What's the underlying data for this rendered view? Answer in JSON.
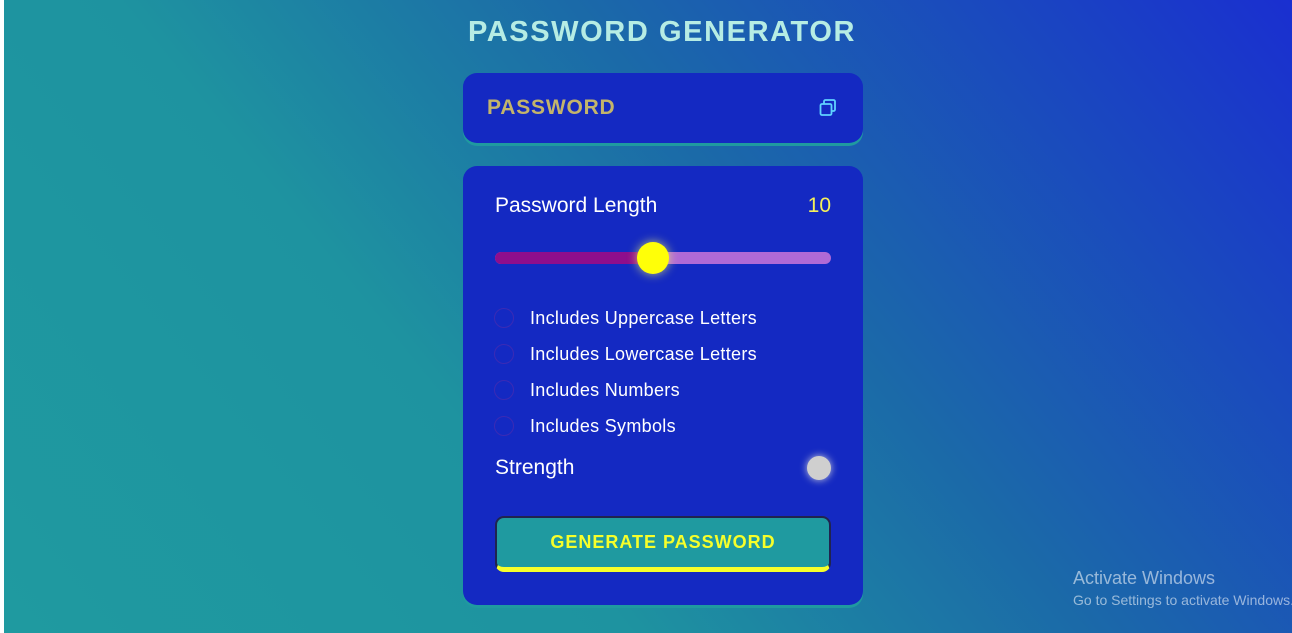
{
  "app": {
    "title": "PASSWORD GENERATOR"
  },
  "display": {
    "placeholder": "PASSWORD",
    "copy_icon": "copy-icon"
  },
  "length": {
    "label": "Password Length",
    "value": "10",
    "slider_fraction": 0.47
  },
  "options": [
    {
      "label": "Includes Uppercase Letters",
      "checked": false
    },
    {
      "label": "Includes Lowercase Letters",
      "checked": false
    },
    {
      "label": "Includes Numbers",
      "checked": false
    },
    {
      "label": "Includes Symbols",
      "checked": false
    }
  ],
  "strength": {
    "label": "Strength",
    "indicator_color": "#cfcfcf"
  },
  "generate": {
    "label": "GENERATE PASSWORD"
  },
  "watermark": {
    "title": "Activate Windows",
    "subtitle": "Go to Settings to activate Windows."
  },
  "colors": {
    "panel": "#1429c2",
    "accent_yellow": "#f6ff2a",
    "teal": "#1f9aa0",
    "slider_fill": "#8e0e8c",
    "slider_track": "#b06ad6"
  }
}
